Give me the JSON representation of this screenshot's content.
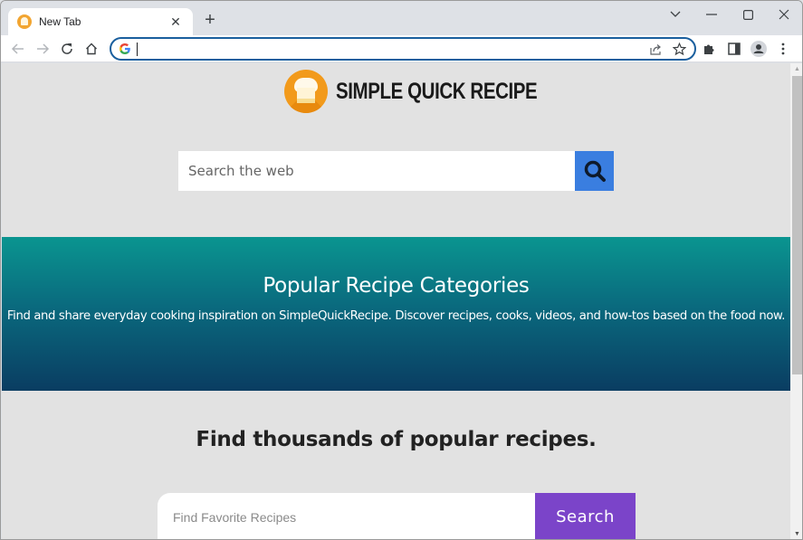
{
  "browser": {
    "tab": {
      "title": "New Tab",
      "close_glyph": "✕"
    },
    "new_tab_glyph": "+",
    "window_controls": {
      "tab_search": "⌄",
      "minimize": "—",
      "maximize": "▢",
      "close": "✕"
    },
    "omnibox": {
      "value": "",
      "placeholder": ""
    },
    "scroll": {
      "position_fraction": 0.0,
      "visible_fraction": 0.66
    }
  },
  "page": {
    "logo_text": "SIMPLE QUICK RECIPE",
    "web_search": {
      "placeholder": "Search the web",
      "value": ""
    },
    "banner": {
      "title": "Popular Recipe Categories",
      "subtitle": "Find and share everyday cooking inspiration on SimpleQuickRecipe. Discover recipes, cooks, videos, and how-tos based on the food now."
    },
    "find_section": {
      "title": "Find thousands of popular recipes.",
      "input_placeholder": "Find Favorite Recipes",
      "input_value": "",
      "button_label": "Search"
    }
  },
  "colors": {
    "web_search_button": "#3a7ee0",
    "recipe_search_button": "#7b44c9",
    "banner_top": "#0a9590",
    "banner_bottom": "#0a3d62",
    "logo_orange": "#f29a1b",
    "omnibox_border": "#1a5f9e"
  }
}
